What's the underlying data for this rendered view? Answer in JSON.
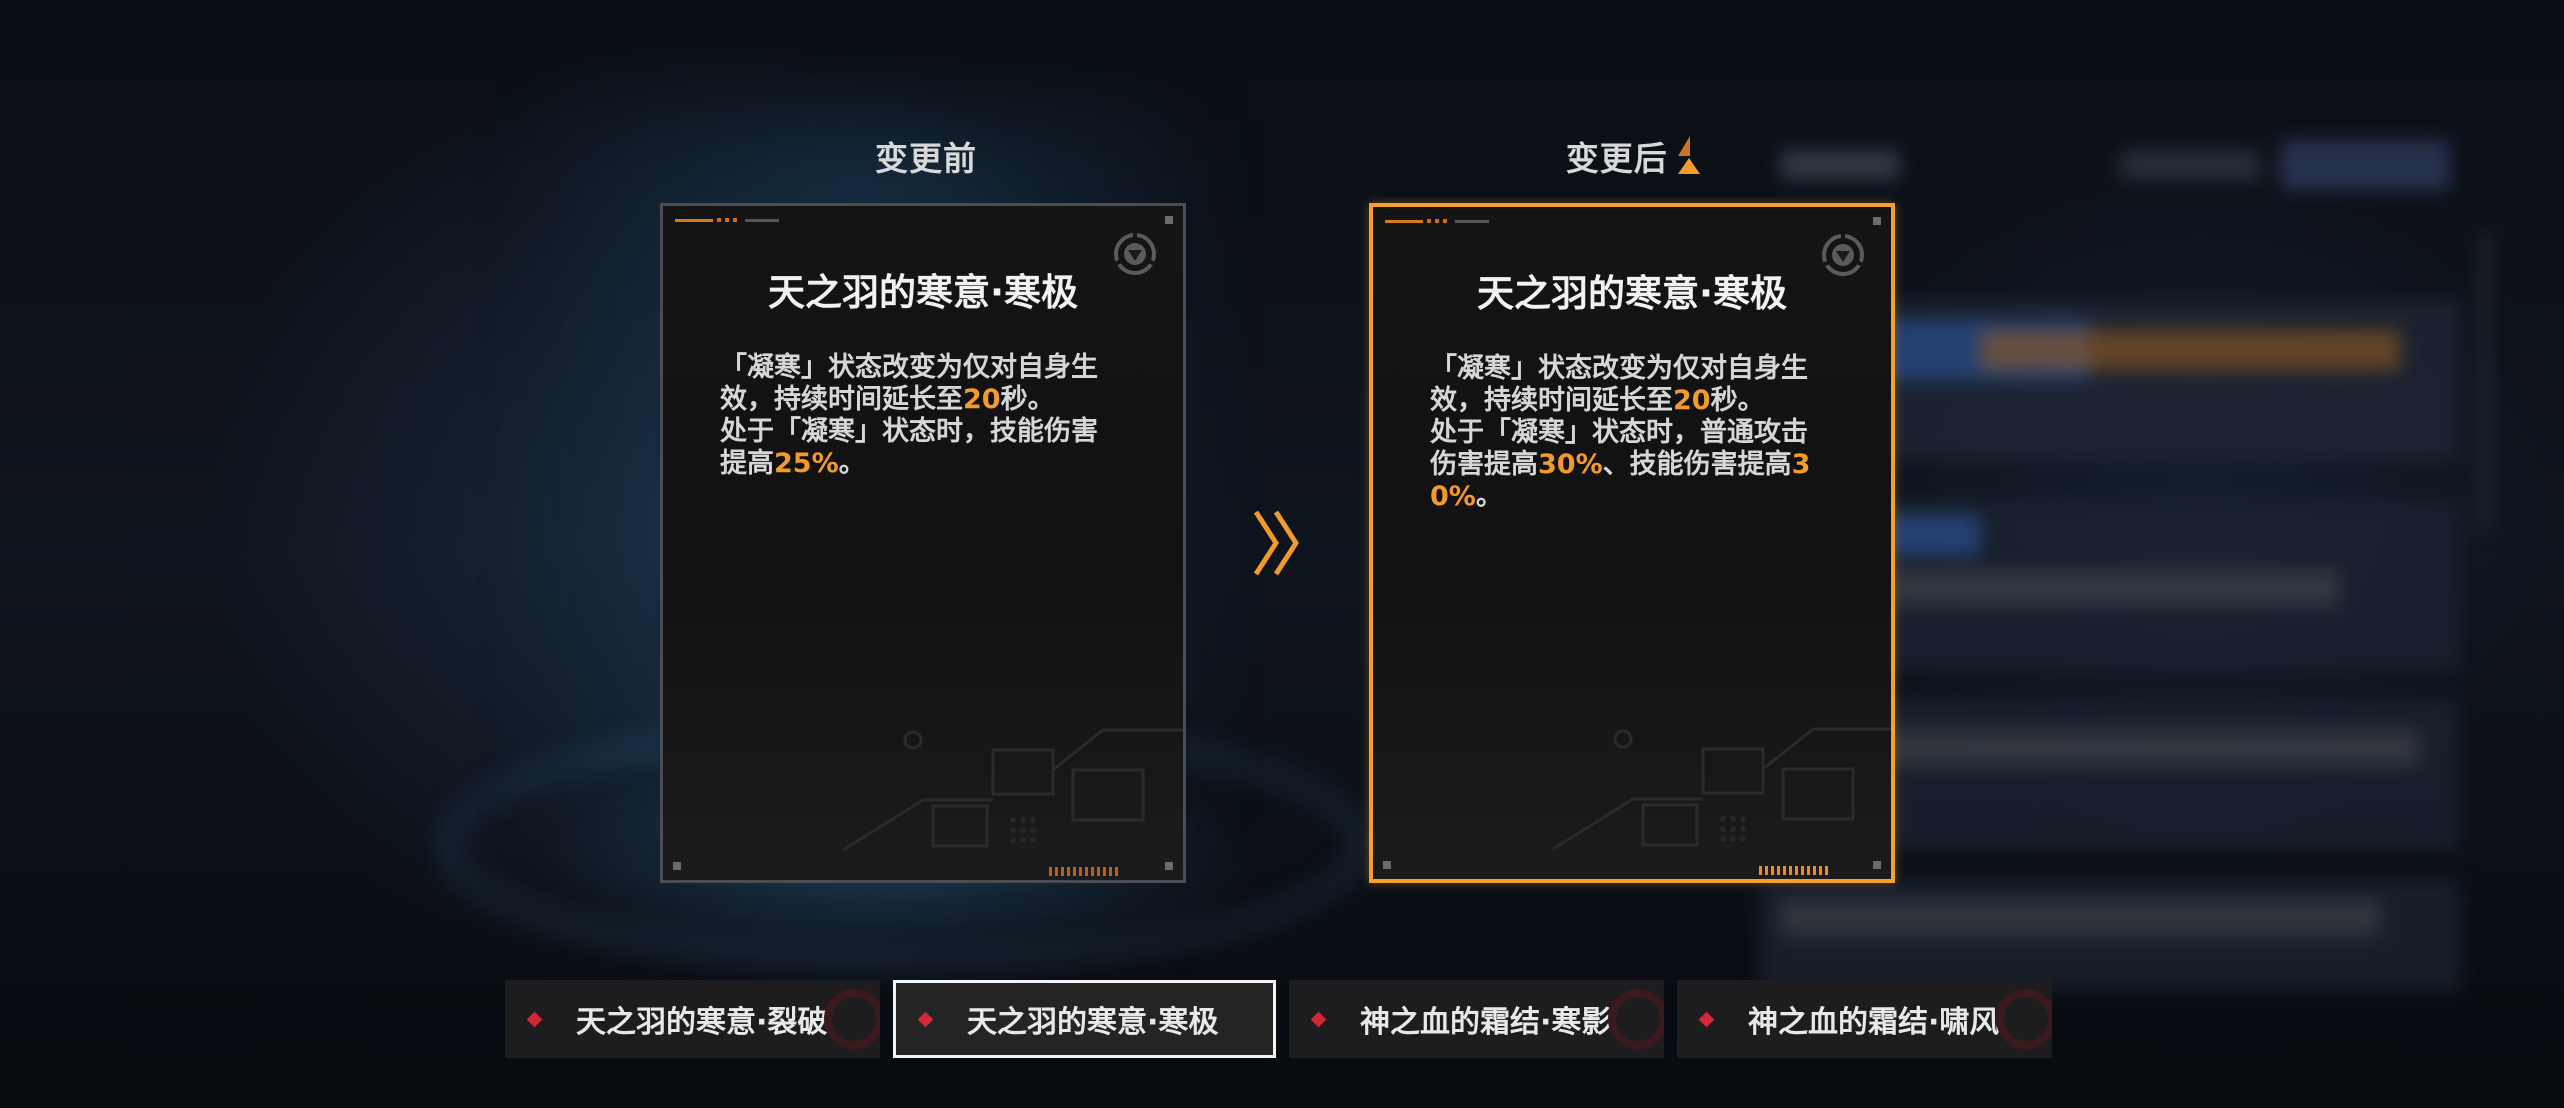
{
  "labels": {
    "before_title": "变更前",
    "after_title": "变更后"
  },
  "before_card": {
    "title": "天之羽的寒意·寒极",
    "desc_parts": [
      {
        "t": "「凝寒」状态改变为仅对自身生效，持续时间延长至"
      },
      {
        "t": "20",
        "hl": true
      },
      {
        "t": "秒。"
      },
      {
        "br": true
      },
      {
        "t": "处于「凝寒」状态时，技能伤害提高"
      },
      {
        "t": "25%",
        "hl": true
      },
      {
        "t": "。"
      }
    ]
  },
  "after_card": {
    "title": "天之羽的寒意·寒极",
    "desc_parts": [
      {
        "t": "「凝寒」状态改变为仅对自身生效，持续时间延长至"
      },
      {
        "t": "20",
        "hl": true
      },
      {
        "t": "秒。"
      },
      {
        "br": true
      },
      {
        "t": "处于「凝寒」状态时，普通攻击伤害提高"
      },
      {
        "t": "30%",
        "hl": true
      },
      {
        "t": "、技能伤害提高"
      },
      {
        "t": "30%",
        "hl": true
      },
      {
        "t": "。"
      }
    ]
  },
  "tabs": [
    {
      "label": "天之羽的寒意·裂破",
      "active": false
    },
    {
      "label": "天之羽的寒意·寒极",
      "active": true
    },
    {
      "label": "神之血的霜结·寒影",
      "active": false
    },
    {
      "label": "神之血的霜结·啸风",
      "active": false
    }
  ],
  "colors": {
    "accent": "#f5a02c",
    "highlight": "#f29a2a",
    "tab_marker": "#d4283a"
  },
  "icons": {
    "card_emblem": "triangle-emblem-icon",
    "transition": "double-chevron-right-icon",
    "new_marker": "corner-triangle-icon"
  }
}
